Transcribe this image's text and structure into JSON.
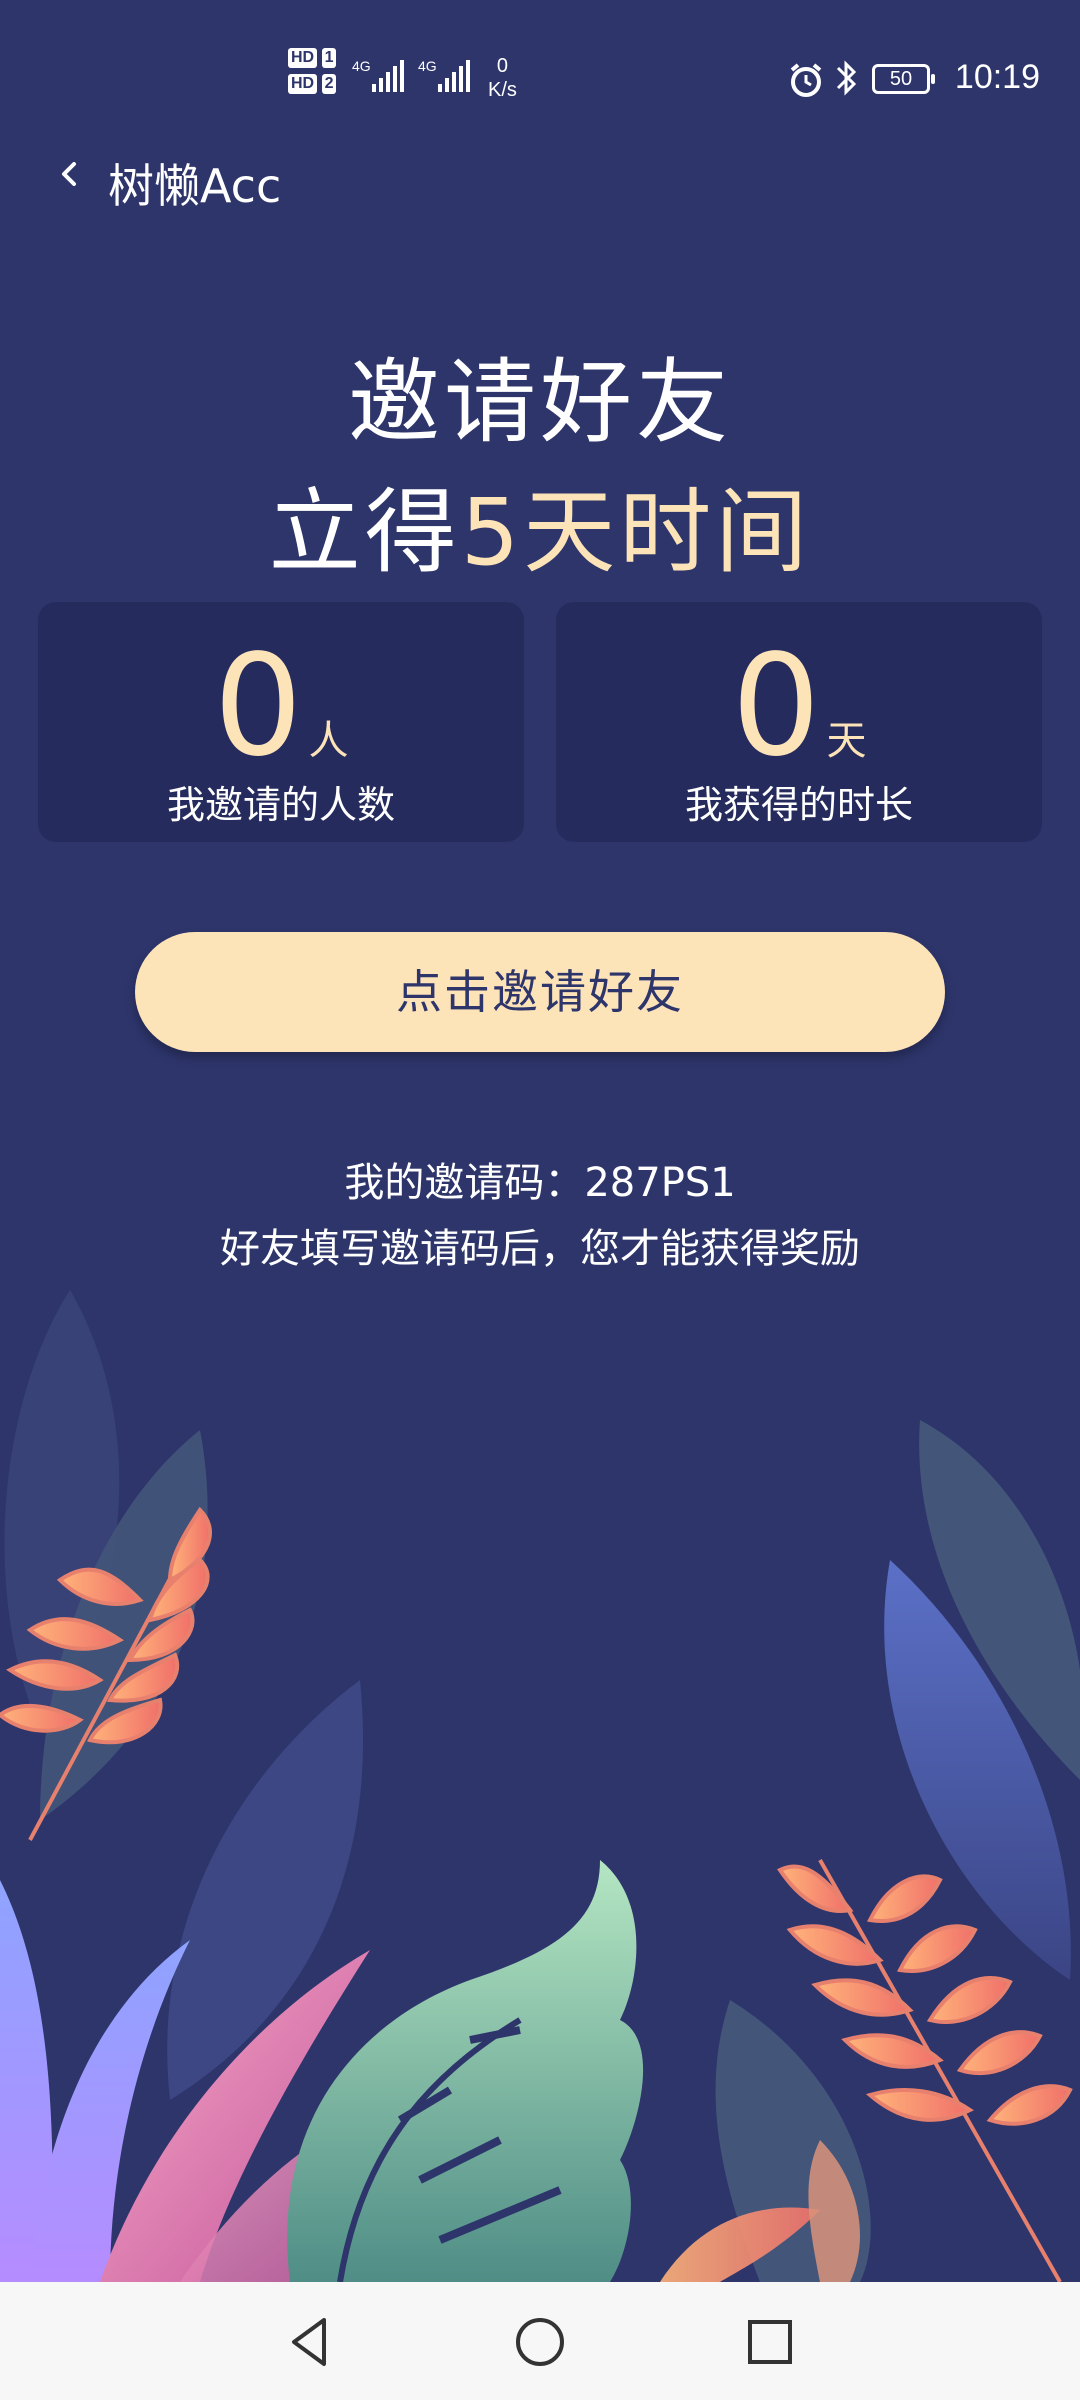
{
  "status_bar": {
    "hd1": "HD",
    "hd1_sim": "1",
    "hd2": "HD",
    "hd2_sim": "2",
    "net1": "4G",
    "net2": "4G",
    "speed_value": "0",
    "speed_unit": "K/s",
    "battery": "50",
    "time": "10:19"
  },
  "header": {
    "title": "树懒Acc"
  },
  "headline": {
    "line1": "邀请好友",
    "line2_prefix": "立得",
    "line2_highlight": "5天时间"
  },
  "stats": [
    {
      "value": "0",
      "unit": "人",
      "label": "我邀请的人数"
    },
    {
      "value": "0",
      "unit": "天",
      "label": "我获得的时长"
    }
  ],
  "cta": {
    "label": "点击邀请好友"
  },
  "invite": {
    "code_line": "我的邀请码：287PS1",
    "note": "好友填写邀请码后，您才能获得奖励"
  },
  "colors": {
    "background": "#2d356b",
    "card": "#252b5d",
    "accent": "#fde3b8"
  },
  "icons": {
    "back": "chevron-left-icon",
    "nav_back": "triangle-back-icon",
    "nav_home": "circle-home-icon",
    "nav_recent": "square-recent-icon"
  }
}
